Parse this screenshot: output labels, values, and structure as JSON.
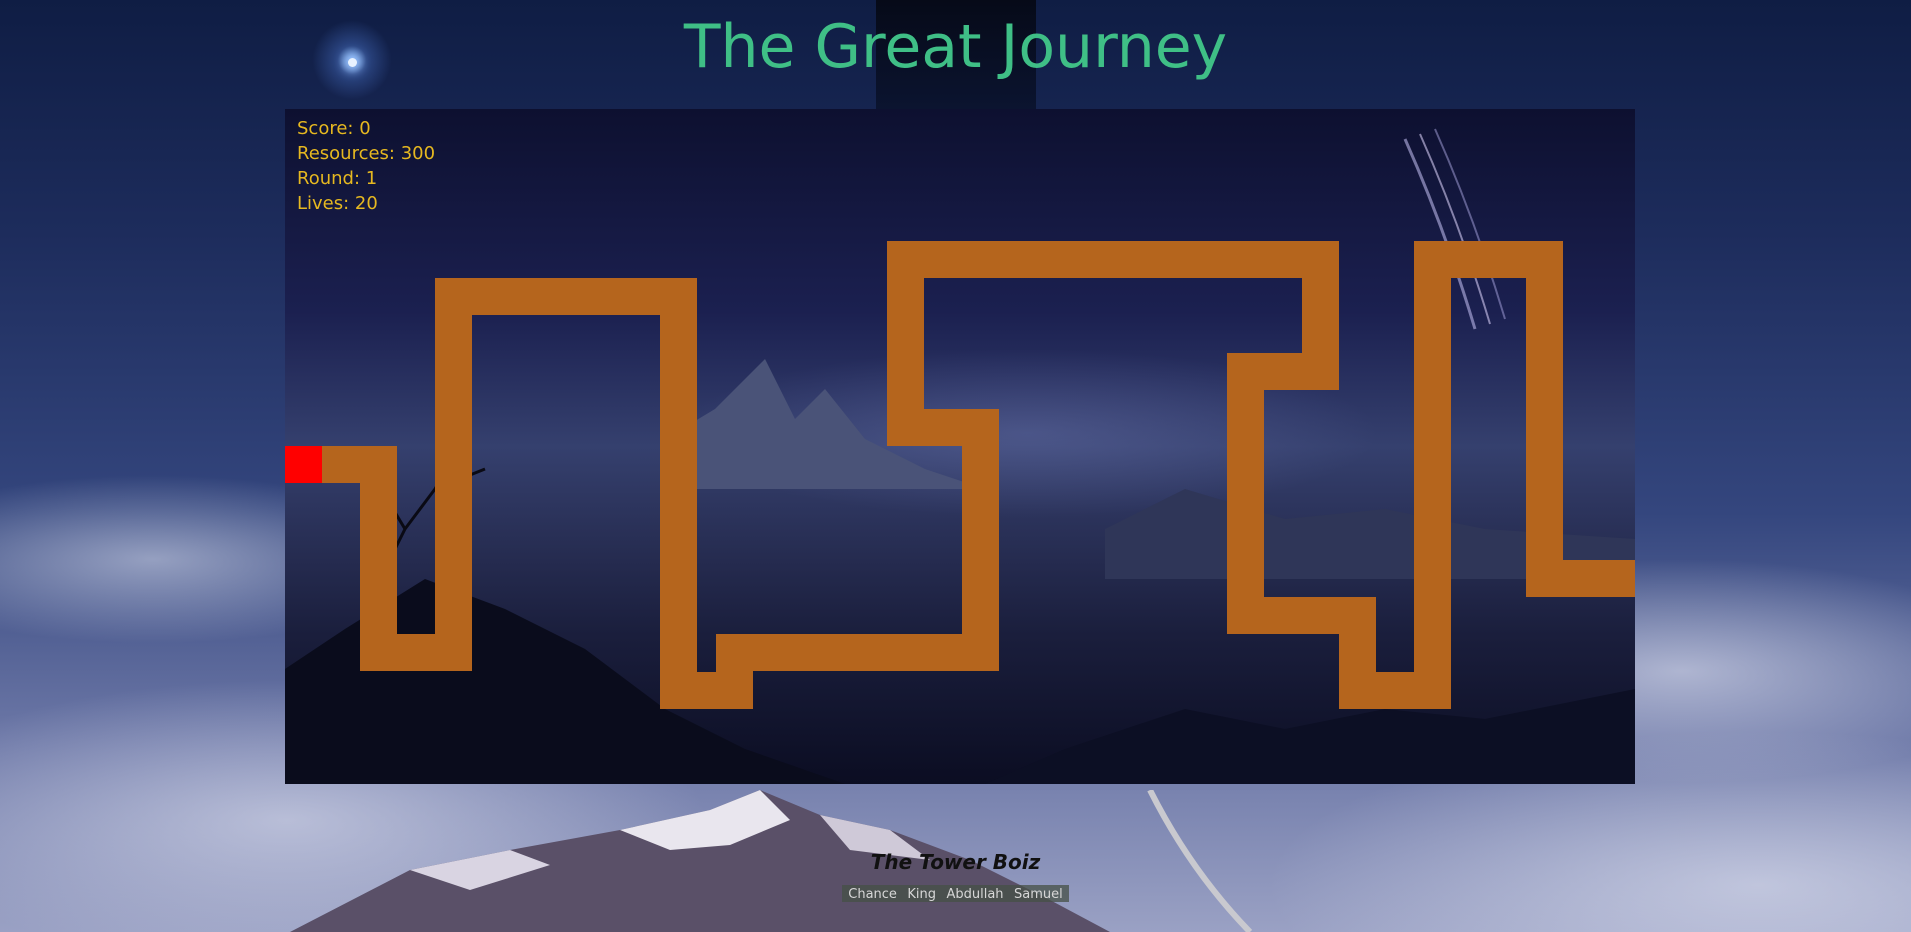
{
  "page": {
    "title": "The Great Journey"
  },
  "hud": {
    "score_label": "Score: 0",
    "resources_label": "Resources: 300",
    "round_label": "Round: 1",
    "lives_label": "Lives: 20"
  },
  "colors": {
    "title": "#3fbf86",
    "hud_text": "#e6b820",
    "path": "#b5651d",
    "spawn": "#ff0000"
  },
  "footer": {
    "team_name": "The Tower Boiz",
    "members": [
      "Chance",
      "King",
      "Abdullah",
      "Samuel"
    ]
  }
}
